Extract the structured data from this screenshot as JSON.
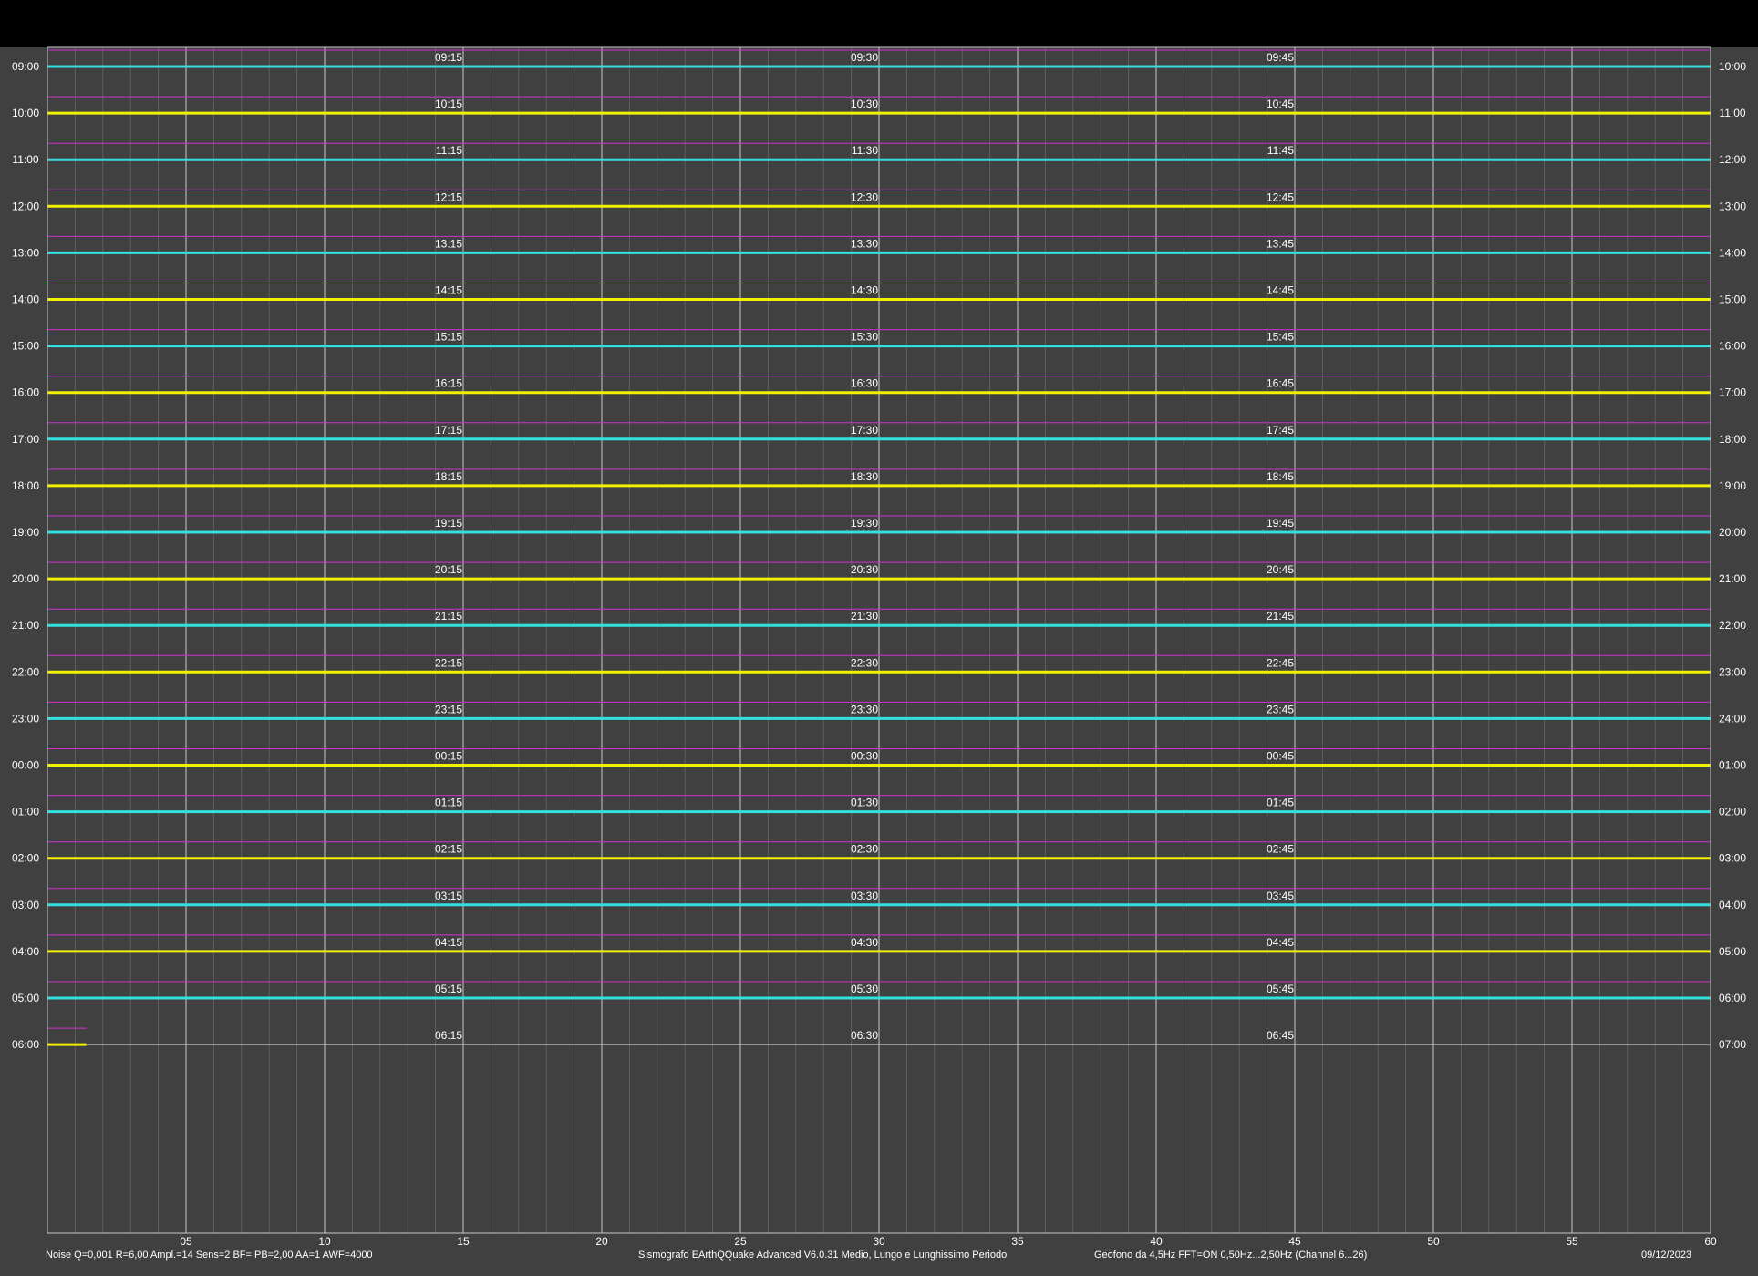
{
  "chart_data": {
    "type": "line",
    "title": "",
    "x": {
      "min": 0,
      "max": 60,
      "major_ticks": [
        5,
        10,
        15,
        20,
        25,
        30,
        35,
        40,
        45,
        50,
        55,
        60
      ],
      "major_tick_labels": [
        "05",
        "10",
        "15",
        "20",
        "25",
        "30",
        "35",
        "40",
        "45",
        "50",
        "55",
        "60"
      ],
      "minor_step": 1
    },
    "rows": [
      {
        "left": "09:00",
        "right": "10:00",
        "q15": "09:15",
        "q30": "09:30",
        "q45": "09:45",
        "color": "#33e0e0"
      },
      {
        "left": "10:00",
        "right": "11:00",
        "q15": "10:15",
        "q30": "10:30",
        "q45": "10:45",
        "color": "#f0f000"
      },
      {
        "left": "11:00",
        "right": "12:00",
        "q15": "11:15",
        "q30": "11:30",
        "q45": "11:45",
        "color": "#33e0e0"
      },
      {
        "left": "12:00",
        "right": "13:00",
        "q15": "12:15",
        "q30": "12:30",
        "q45": "12:45",
        "color": "#f0f000"
      },
      {
        "left": "13:00",
        "right": "14:00",
        "q15": "13:15",
        "q30": "13:30",
        "q45": "13:45",
        "color": "#33e0e0"
      },
      {
        "left": "14:00",
        "right": "15:00",
        "q15": "14:15",
        "q30": "14:30",
        "q45": "14:45",
        "color": "#f0f000"
      },
      {
        "left": "15:00",
        "right": "16:00",
        "q15": "15:15",
        "q30": "15:30",
        "q45": "15:45",
        "color": "#33e0e0"
      },
      {
        "left": "16:00",
        "right": "17:00",
        "q15": "16:15",
        "q30": "16:30",
        "q45": "16:45",
        "color": "#f0f000"
      },
      {
        "left": "17:00",
        "right": "18:00",
        "q15": "17:15",
        "q30": "17:30",
        "q45": "17:45",
        "color": "#33e0e0"
      },
      {
        "left": "18:00",
        "right": "19:00",
        "q15": "18:15",
        "q30": "18:30",
        "q45": "18:45",
        "color": "#f0f000"
      },
      {
        "left": "19:00",
        "right": "20:00",
        "q15": "19:15",
        "q30": "19:30",
        "q45": "19:45",
        "color": "#33e0e0"
      },
      {
        "left": "20:00",
        "right": "21:00",
        "q15": "20:15",
        "q30": "20:30",
        "q45": "20:45",
        "color": "#f0f000"
      },
      {
        "left": "21:00",
        "right": "22:00",
        "q15": "21:15",
        "q30": "21:30",
        "q45": "21:45",
        "color": "#33e0e0"
      },
      {
        "left": "22:00",
        "right": "23:00",
        "q15": "22:15",
        "q30": "22:30",
        "q45": "22:45",
        "color": "#f0f000"
      },
      {
        "left": "23:00",
        "right": "24:00",
        "q15": "23:15",
        "q30": "23:30",
        "q45": "23:45",
        "color": "#33e0e0"
      },
      {
        "left": "00:00",
        "right": "01:00",
        "q15": "00:15",
        "q30": "00:30",
        "q45": "00:45",
        "color": "#f0f000"
      },
      {
        "left": "01:00",
        "right": "02:00",
        "q15": "01:15",
        "q30": "01:30",
        "q45": "01:45",
        "color": "#33e0e0"
      },
      {
        "left": "02:00",
        "right": "03:00",
        "q15": "02:15",
        "q30": "02:30",
        "q45": "02:45",
        "color": "#f0f000"
      },
      {
        "left": "03:00",
        "right": "04:00",
        "q15": "03:15",
        "q30": "03:30",
        "q45": "03:45",
        "color": "#33e0e0"
      },
      {
        "left": "04:00",
        "right": "05:00",
        "q15": "04:15",
        "q30": "04:30",
        "q45": "04:45",
        "color": "#f0f000"
      },
      {
        "left": "05:00",
        "right": "06:00",
        "q15": "05:15",
        "q30": "05:30",
        "q45": "05:45",
        "color": "#33e0e0"
      },
      {
        "left": "06:00",
        "right": "07:00",
        "q15": "06:15",
        "q30": "06:30",
        "q45": "06:45",
        "color": "#f0f000",
        "trace_end_minute": 1.4
      }
    ],
    "colors": {
      "background": "#404040",
      "top_band": "#000000",
      "trace_a": "#33e0e0",
      "trace_b": "#f0f000",
      "guide": "#cc33cc",
      "grid_major": "#c8c8c8",
      "grid_minor": "#5e5e5e"
    }
  },
  "footer": {
    "left": "Noise Q=0,001 R=6,00 Ampl.=14 Sens=2 BF= PB=2,00 AA=1 AWF=4000",
    "center": "Sismografo  EArthQQuake Advanced V6.0.31  Medio, Lungo e Lunghissimo Periodo",
    "right": "Geofono da 4,5Hz FFT=ON 0,50Hz...2,50Hz      (Channel 6...26)",
    "date": "09/12/2023"
  }
}
